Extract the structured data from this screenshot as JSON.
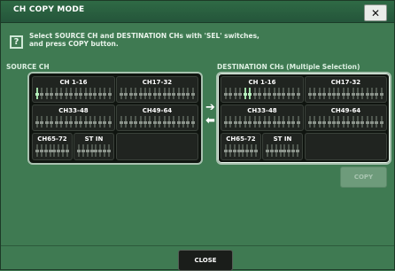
{
  "window": {
    "title": "CH COPY MODE",
    "close_glyph": "✕"
  },
  "help": {
    "icon_glyph": "?",
    "line1": "Select SOURCE CH and DESTINATION CHs with 'SEL' switches,",
    "line2": "and press COPY button."
  },
  "source": {
    "label": "SOURCE CH",
    "blocks": [
      "CH 1-16",
      "CH17-32",
      "CH33-48",
      "CH49-64",
      "CH65-72",
      "ST IN"
    ],
    "selected_channel": "CH 1"
  },
  "destination": {
    "label": "DESTINATION CHs (Multiple Selection)",
    "blocks": [
      "CH 1-16",
      "CH17-32",
      "CH33-48",
      "CH49-64",
      "CH65-72",
      "ST IN"
    ],
    "selected_channels": [
      "CH 5",
      "CH 6"
    ]
  },
  "arrows": {
    "right": "➔",
    "left": "⬅"
  },
  "buttons": {
    "copy": "COPY",
    "close": "CLOSE"
  },
  "colors": {
    "background": "#3f7a52",
    "titlebar": "#2f6a45",
    "panel": "#0f140f",
    "selected_fader": "#9fdca6"
  }
}
